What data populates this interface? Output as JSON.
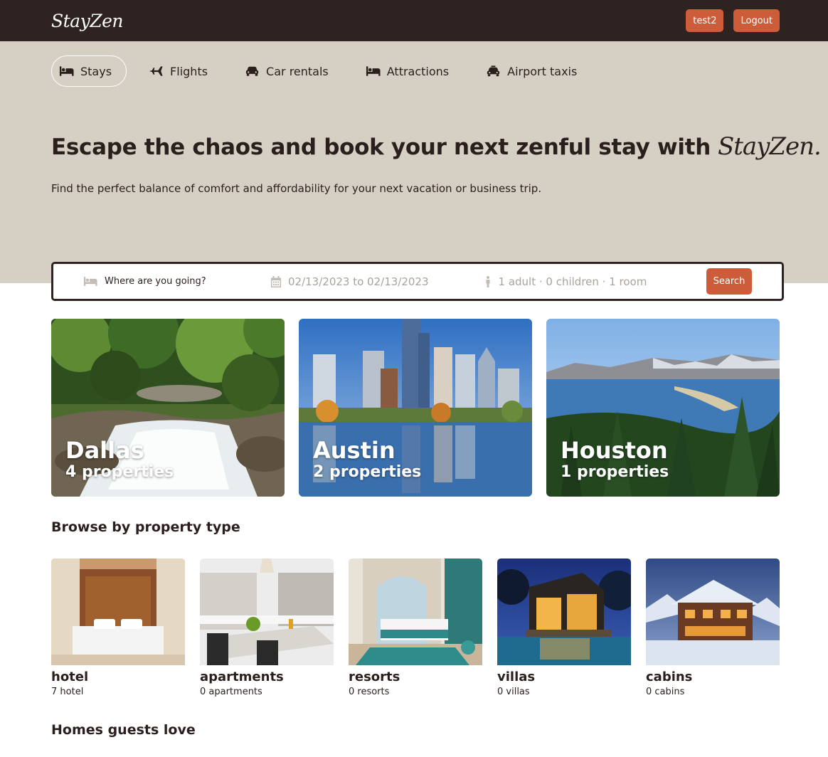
{
  "navbar": {
    "logo": "StayZen",
    "user_label": "test2",
    "logout_label": "Logout"
  },
  "tabs": [
    {
      "label": "Stays",
      "icon": "bed-icon",
      "active": true
    },
    {
      "label": "Flights",
      "icon": "plane-icon",
      "active": false
    },
    {
      "label": "Car rentals",
      "icon": "car-icon",
      "active": false
    },
    {
      "label": "Attractions",
      "icon": "bed-icon",
      "active": false
    },
    {
      "label": "Airport taxis",
      "icon": "taxi-icon",
      "active": false
    }
  ],
  "hero": {
    "headline": "Escape the chaos and book your next zenful stay with",
    "brand": "StayZen.",
    "subline": "Find the perfect balance of comfort and affordability for your next vacation or business trip."
  },
  "search": {
    "destination_placeholder": "Where are you going?",
    "dates": "02/13/2023 to 02/13/2023",
    "guests": "1 adult · 0 children · 1 room",
    "button": "Search"
  },
  "cities": [
    {
      "name": "Dallas",
      "count": "4 properties"
    },
    {
      "name": "Austin",
      "count": "2 properties"
    },
    {
      "name": "Houston",
      "count": "1 properties"
    }
  ],
  "property_section_title": "Browse by property type",
  "property_types": [
    {
      "name": "hotel",
      "count": "7 hotel"
    },
    {
      "name": "apartments",
      "count": "0 apartments"
    },
    {
      "name": "resorts",
      "count": "0 resorts"
    },
    {
      "name": "villas",
      "count": "0 villas"
    },
    {
      "name": "cabins",
      "count": "0 cabins"
    }
  ],
  "homes_section_title": "Homes guests love",
  "colors": {
    "nav_bg": "#2e2321",
    "hero_bg": "#d6cfc4",
    "accent": "#cd5d3a"
  }
}
